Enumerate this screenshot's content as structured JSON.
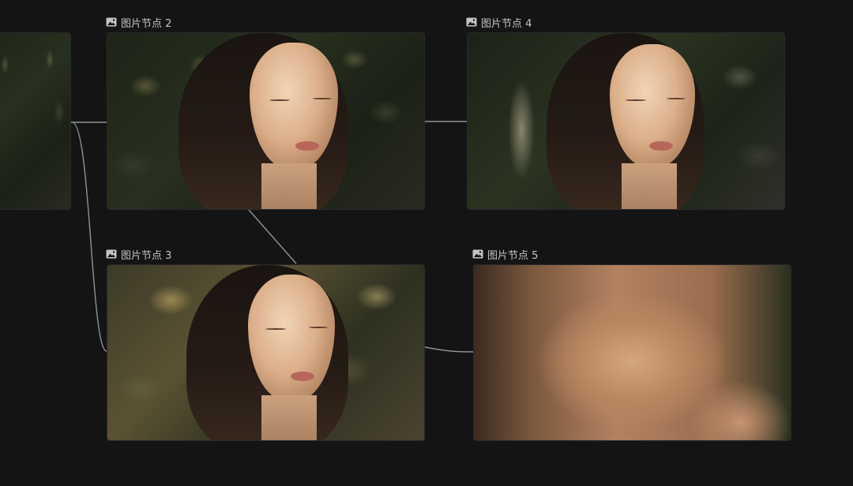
{
  "canvas": {
    "background": "#141415",
    "edge_color": "#8f9197",
    "label_color": "#c3c4c8"
  },
  "nodes": [
    {
      "id": "node-1",
      "label": "",
      "icon": "image-icon",
      "kind": "portrait-dark"
    },
    {
      "id": "node-2",
      "label": "图片节点 2",
      "icon": "image-icon",
      "kind": "portrait-dark"
    },
    {
      "id": "node-3",
      "label": "图片节点 3",
      "icon": "image-icon",
      "kind": "portrait-warm"
    },
    {
      "id": "node-4",
      "label": "图片节点 4",
      "icon": "image-icon",
      "kind": "portrait-park"
    },
    {
      "id": "node-5",
      "label": "图片节点 5",
      "icon": "image-icon",
      "kind": "closeup-eye"
    }
  ],
  "edges": [
    {
      "from": "node-1",
      "to": "node-2"
    },
    {
      "from": "node-1",
      "to": "node-3"
    },
    {
      "from": "node-2",
      "to": "node-3"
    },
    {
      "from": "node-2",
      "to": "node-4"
    },
    {
      "from": "node-3",
      "to": "node-5"
    }
  ]
}
